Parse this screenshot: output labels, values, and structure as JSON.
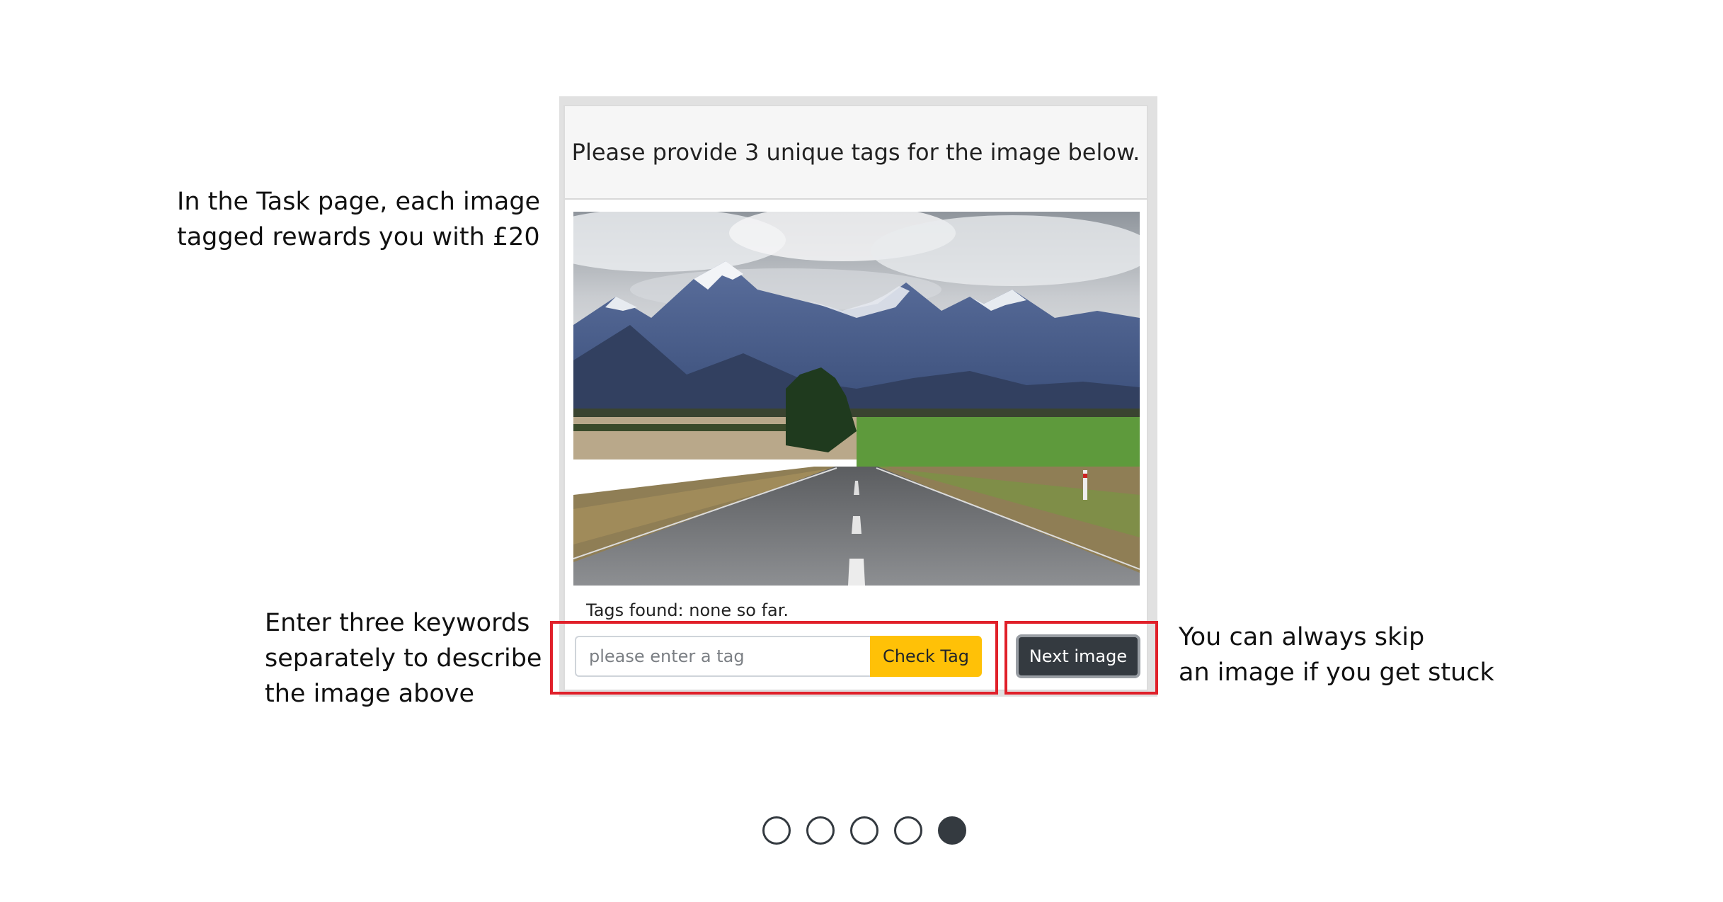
{
  "annotations": {
    "left_top": "In the Task page, each image\ntagged rewards you with £20",
    "left_bottom": "Enter three keywords\nseparately to describe\nthe image above",
    "right": "You can always skip\nan image if you get stuck"
  },
  "card": {
    "header": "Please provide 3 unique tags for the image below.",
    "tags_found": "Tags found: none so far.",
    "input_placeholder": "please enter a tag",
    "check_button": "Check Tag",
    "next_button": "Next image"
  },
  "colors": {
    "highlight": "#e0202a",
    "check_button_bg": "#ffc107",
    "next_button_bg": "#343a40",
    "dot_color": "#343a40"
  },
  "pagination": {
    "total": 5,
    "active_index": 4
  }
}
